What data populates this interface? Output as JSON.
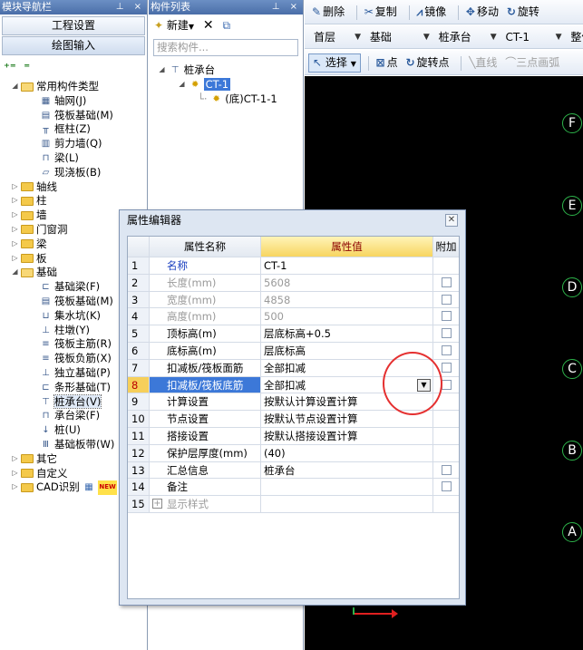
{
  "nav_pane": {
    "title": "模块导航栏",
    "buttons": [
      "工程设置",
      "绘图输入"
    ],
    "tree": [
      {
        "label": "常用构件类型",
        "kind": "folder",
        "level": 0,
        "expanded": true
      },
      {
        "label": "轴网(J)",
        "kind": "item",
        "level": 1,
        "icon": "grid-icon"
      },
      {
        "label": "筏板基础(M)",
        "kind": "item",
        "level": 1,
        "icon": "raft-icon"
      },
      {
        "label": "框柱(Z)",
        "kind": "item",
        "level": 1,
        "icon": "column-icon"
      },
      {
        "label": "剪力墙(Q)",
        "kind": "item",
        "level": 1,
        "icon": "wall-icon"
      },
      {
        "label": "梁(L)",
        "kind": "item",
        "level": 1,
        "icon": "beam-icon"
      },
      {
        "label": "现浇板(B)",
        "kind": "item",
        "level": 1,
        "icon": "slab-icon"
      },
      {
        "label": "轴线",
        "kind": "folder",
        "level": 0
      },
      {
        "label": "柱",
        "kind": "folder",
        "level": 0
      },
      {
        "label": "墙",
        "kind": "folder",
        "level": 0
      },
      {
        "label": "门窗洞",
        "kind": "folder",
        "level": 0
      },
      {
        "label": "梁",
        "kind": "folder",
        "level": 0
      },
      {
        "label": "板",
        "kind": "folder",
        "level": 0
      },
      {
        "label": "基础",
        "kind": "folder",
        "level": 0,
        "expanded": true
      },
      {
        "label": "基础梁(F)",
        "kind": "item",
        "level": 1,
        "icon": "foundation-beam-icon"
      },
      {
        "label": "筏板基础(M)",
        "kind": "item",
        "level": 1,
        "icon": "raft-icon"
      },
      {
        "label": "集水坑(K)",
        "kind": "item",
        "level": 1,
        "icon": "sump-icon"
      },
      {
        "label": "柱墩(Y)",
        "kind": "item",
        "level": 1,
        "icon": "pier-icon"
      },
      {
        "label": "筏板主筋(R)",
        "kind": "item",
        "level": 1,
        "icon": "rebar-icon"
      },
      {
        "label": "筏板负筋(X)",
        "kind": "item",
        "level": 1,
        "icon": "rebar-icon"
      },
      {
        "label": "独立基础(P)",
        "kind": "item",
        "level": 1,
        "icon": "isolated-footing-icon"
      },
      {
        "label": "条形基础(T)",
        "kind": "item",
        "level": 1,
        "icon": "strip-footing-icon"
      },
      {
        "label": "桩承台(V)",
        "kind": "item",
        "level": 1,
        "icon": "pile-cap-icon",
        "selected": true
      },
      {
        "label": "承台梁(F)",
        "kind": "item",
        "level": 1,
        "icon": "cap-beam-icon"
      },
      {
        "label": "桩(U)",
        "kind": "item",
        "level": 1,
        "icon": "pile-icon"
      },
      {
        "label": "基础板带(W)",
        "kind": "item",
        "level": 1,
        "icon": "slab-strip-icon"
      },
      {
        "label": "其它",
        "kind": "folder",
        "level": 0
      },
      {
        "label": "自定义",
        "kind": "folder",
        "level": 0
      },
      {
        "label": "CAD识别",
        "kind": "folder",
        "level": 0,
        "badge": "NEW"
      }
    ]
  },
  "component_pane": {
    "title": "构件列表",
    "new_label": "新建",
    "search_placeholder": "搜索构件...",
    "tree": [
      {
        "label": "桩承台",
        "level": 0,
        "icon": "pile-cap-icon"
      },
      {
        "label": "CT-1",
        "level": 1,
        "icon": "gear-icon",
        "selected": true
      },
      {
        "label": "(底)CT-1-1",
        "level": 2,
        "icon": "gear-icon"
      }
    ]
  },
  "toolbar1": {
    "delete": "删除",
    "copy": "复制",
    "mirror": "镜像",
    "move": "移动",
    "rotate": "旋转"
  },
  "toolbar2": {
    "floor": "首层",
    "category": "基础",
    "type": "桩承台",
    "component": "CT-1",
    "extra": "整体"
  },
  "toolbar3": {
    "select": "选择",
    "point": "点",
    "rotate_point": "旋转点",
    "line": "直线",
    "arc": "三点画弧"
  },
  "canvas": {
    "axes": [
      "F",
      "E",
      "D",
      "C",
      "B",
      "A"
    ]
  },
  "dialog": {
    "title": "属性编辑器",
    "headers": {
      "name": "属性名称",
      "value": "属性值",
      "extra": "附加"
    },
    "rows": [
      {
        "num": "1",
        "name": "名称",
        "value": "CT-1",
        "style": "blue",
        "check": false
      },
      {
        "num": "2",
        "name": "长度(mm)",
        "value": "5608",
        "style": "grey",
        "check": true
      },
      {
        "num": "3",
        "name": "宽度(mm)",
        "value": "4858",
        "style": "grey",
        "check": true
      },
      {
        "num": "4",
        "name": "高度(mm)",
        "value": "500",
        "style": "grey",
        "check": true
      },
      {
        "num": "5",
        "name": "顶标高(m)",
        "value": "层底标高+0.5",
        "style": "",
        "check": true
      },
      {
        "num": "6",
        "name": "底标高(m)",
        "value": "层底标高",
        "style": "",
        "check": true
      },
      {
        "num": "7",
        "name": "扣减板/筏板面筋",
        "value": "全部扣减",
        "style": "",
        "check": true
      },
      {
        "num": "8",
        "name": "扣减板/筏板底筋",
        "value": "全部扣减",
        "style": "",
        "check": true,
        "selected": true
      },
      {
        "num": "9",
        "name": "计算设置",
        "value": "按默认计算设置计算",
        "style": "",
        "check": false
      },
      {
        "num": "10",
        "name": "节点设置",
        "value": "按默认节点设置计算",
        "style": "",
        "check": false
      },
      {
        "num": "11",
        "name": "搭接设置",
        "value": "按默认搭接设置计算",
        "style": "",
        "check": false
      },
      {
        "num": "12",
        "name": "保护层厚度(mm)",
        "value": "(40)",
        "style": "",
        "check": false
      },
      {
        "num": "13",
        "name": "汇总信息",
        "value": "桩承台",
        "style": "",
        "check": true
      },
      {
        "num": "14",
        "name": "备注",
        "value": "",
        "style": "",
        "check": true
      },
      {
        "num": "15",
        "name": "显示样式",
        "value": "",
        "style": "grey",
        "check": false,
        "expandable": true
      }
    ]
  },
  "colors": {
    "accent": "#3c78d8",
    "header_value": "#f7d560",
    "canvas": "#000000",
    "axis": "#2db34a",
    "annotation": "#e53030"
  }
}
